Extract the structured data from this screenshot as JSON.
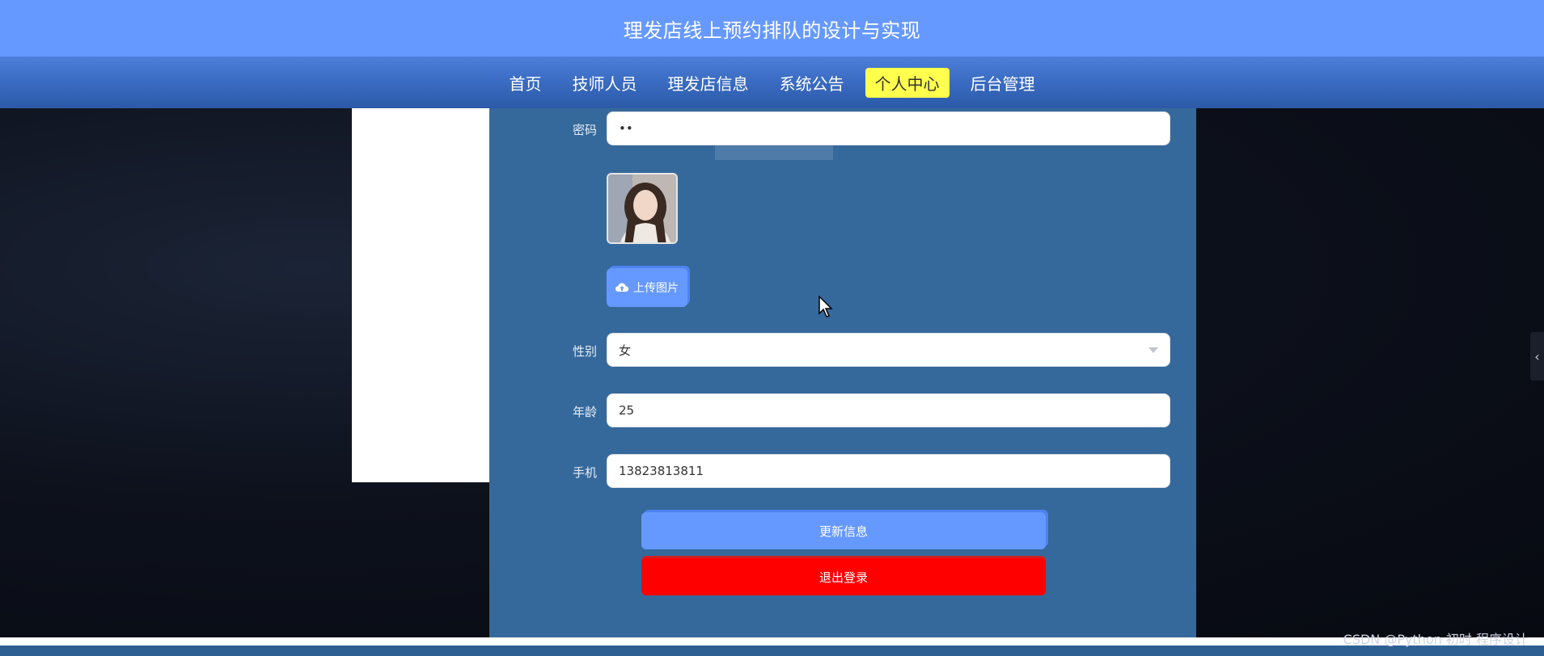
{
  "header": {
    "title": "理发店线上预约排队的设计与实现"
  },
  "nav": {
    "items": [
      {
        "label": "首页"
      },
      {
        "label": "技师人员"
      },
      {
        "label": "理发店信息"
      },
      {
        "label": "系统公告"
      },
      {
        "label": "个人中心",
        "active": true
      },
      {
        "label": "后台管理"
      }
    ]
  },
  "form": {
    "password": {
      "label": "密码",
      "value": "••"
    },
    "avatar": {
      "upload_label": "上传图片"
    },
    "gender": {
      "label": "性别",
      "value": "女"
    },
    "age": {
      "label": "年龄",
      "value": "25"
    },
    "phone": {
      "label": "手机",
      "value": "13823813811"
    },
    "update_label": "更新信息",
    "logout_label": "退出登录"
  },
  "watermark": "CSDN @Python 初时 程序设计",
  "colors": {
    "primary": "#6699ff",
    "panel": "#36699b",
    "active_nav": "#ffff4d",
    "danger": "#ff0000"
  }
}
